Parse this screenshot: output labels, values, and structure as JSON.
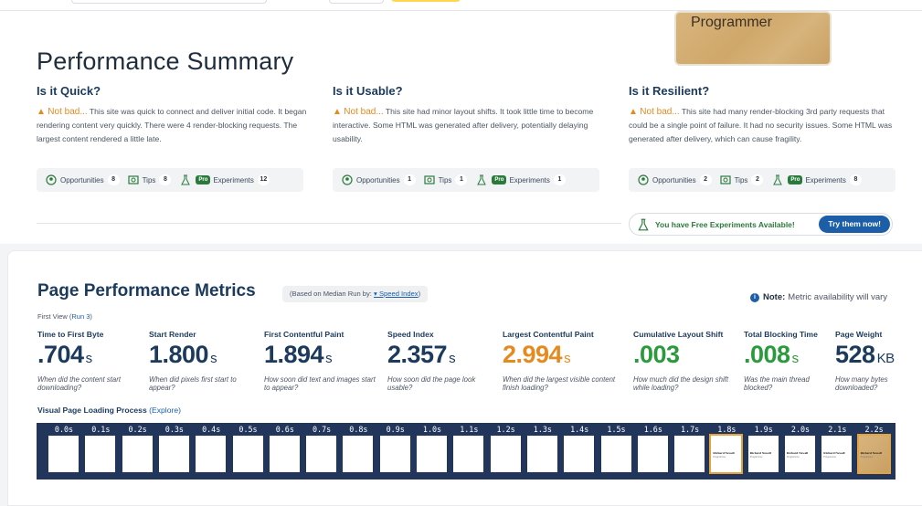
{
  "thumbnail_card": {
    "text": "Programmer"
  },
  "summary": {
    "title": "Performance Summary",
    "columns": [
      {
        "heading": "Is it Quick?",
        "status": "Not bad...",
        "description": " This site was quick to connect and deliver initial code. It began rendering content very quickly. There were 4 render-blocking requests. The largest content rendered a little late.",
        "opportunities_label": "Opportunities",
        "opportunities_count": "8",
        "tips_label": "Tips",
        "tips_count": "8",
        "pro_label": "Pro",
        "experiments_label": "Experiments",
        "experiments_count": "12"
      },
      {
        "heading": "Is it Usable?",
        "status": "Not bad...",
        "description": " This site had minor layout shifts. It took little time to become interactive. Some HTML was generated after delivery, potentially delaying usability.",
        "opportunities_label": "Opportunities",
        "opportunities_count": "1",
        "tips_label": "Tips",
        "tips_count": "1",
        "pro_label": "Pro",
        "experiments_label": "Experiments",
        "experiments_count": "1"
      },
      {
        "heading": "Is it Resilient?",
        "status": "Not bad...",
        "description": " This site had many render-blocking 3rd party requests that could be a single point of failure. It had no security issues. Some HTML was generated after delivery, which can cause fragility.",
        "opportunities_label": "Opportunities",
        "opportunities_count": "2",
        "tips_label": "Tips",
        "tips_count": "2",
        "pro_label": "Pro",
        "experiments_label": "Experiments",
        "experiments_count": "8"
      }
    ],
    "free_experiments": {
      "label": "You have Free Experiments Available!",
      "button": "Try them now!"
    }
  },
  "metrics": {
    "title": "Page Performance Metrics",
    "based_on_prefix": "(Based on Median Run by: ",
    "based_on_link": "▾ Speed Index",
    "based_on_suffix": ")",
    "note_bold": "Note:",
    "note_text": "Metric availability will vary",
    "first_view_prefix": "First View (",
    "first_view_link": "Run 3",
    "first_view_suffix": ")",
    "items": [
      {
        "title": "Time to First Byte",
        "value": ".704",
        "unit": "s",
        "desc": "When did the content start downloading?",
        "color": "#1b3a5c"
      },
      {
        "title": "Start Render",
        "value": "1.800",
        "unit": "s",
        "desc": "When did pixels first start to appear?",
        "color": "#1b3a5c"
      },
      {
        "title": "First Contentful Paint",
        "value": "1.894",
        "unit": "s",
        "desc": "How soon did text and images start to appear?",
        "color": "#1b3a5c"
      },
      {
        "title": "Speed Index",
        "value": "2.357",
        "unit": "s",
        "desc": "How soon did the page look usable?",
        "color": "#1b3a5c"
      },
      {
        "title": "Largest Contentful Paint",
        "value": "2.994",
        "unit": "s",
        "desc": "When did the largest visible content finish loading?",
        "color": "#e58a1f"
      },
      {
        "title": "Cumulative Layout Shift",
        "value": ".003",
        "unit": "",
        "desc": "How much did the design shift while loading?",
        "color": "#2b9a3c"
      },
      {
        "title": "Total Blocking Time",
        "value": ".008",
        "unit": "s",
        "desc": "Was the main thread blocked?",
        "color": "#2b9a3c"
      },
      {
        "title": "Page Weight",
        "value": "528",
        "unit": "KB",
        "desc": "How many bytes downloaded?",
        "color": "#1b3a5c"
      }
    ],
    "visual_loading_label": "Visual Page Loading Process ",
    "explore_link": "(Explore)",
    "frames": [
      "0.0s",
      "0.1s",
      "0.2s",
      "0.3s",
      "0.4s",
      "0.5s",
      "0.6s",
      "0.7s",
      "0.8s",
      "0.9s",
      "1.0s",
      "1.1s",
      "1.2s",
      "1.3s",
      "1.4s",
      "1.5s",
      "1.6s",
      "1.7s",
      "1.8s",
      "1.9s",
      "2.0s",
      "2.1s",
      "2.2s"
    ],
    "frame_name_text": "Richard Newell",
    "frame_sub_text": "Programmer"
  }
}
